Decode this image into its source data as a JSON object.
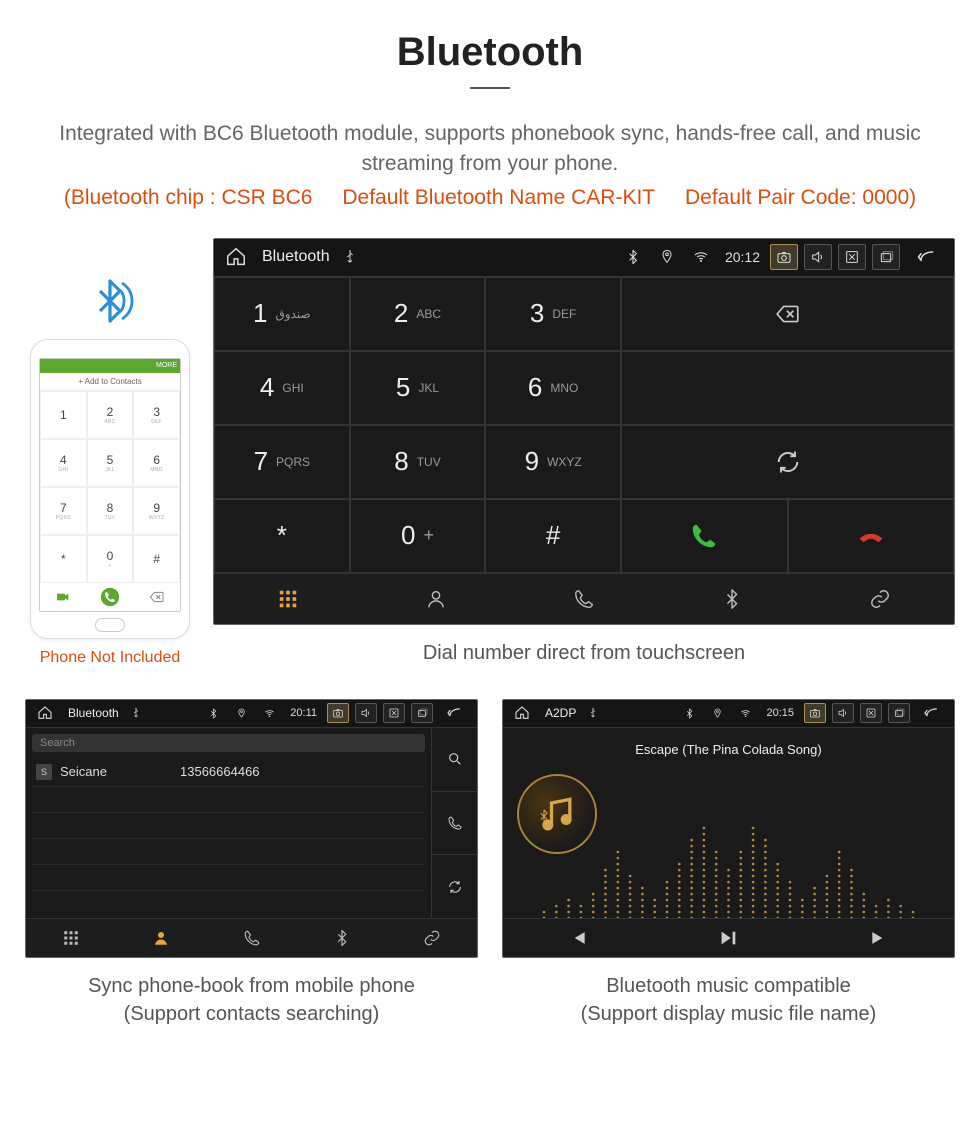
{
  "header": {
    "title": "Bluetooth",
    "description": "Integrated with BC6 Bluetooth module, supports phonebook sync, hands-free call, and music streaming from your phone.",
    "spec_chip": "(Bluetooth chip : CSR BC6",
    "spec_name": "Default Bluetooth Name CAR-KIT",
    "spec_pair": "Default Pair Code: 0000)"
  },
  "phone_mock": {
    "top_label": "MORE",
    "add_contact": "+  Add to Contacts",
    "keys": [
      {
        "d": "1",
        "l": ""
      },
      {
        "d": "2",
        "l": "ABC"
      },
      {
        "d": "3",
        "l": "DEF"
      },
      {
        "d": "4",
        "l": "GHI"
      },
      {
        "d": "5",
        "l": "JKL"
      },
      {
        "d": "6",
        "l": "MNO"
      },
      {
        "d": "7",
        "l": "PQRS"
      },
      {
        "d": "8",
        "l": "TUV"
      },
      {
        "d": "9",
        "l": "WXYZ"
      },
      {
        "d": "*",
        "l": ""
      },
      {
        "d": "0",
        "l": "+"
      },
      {
        "d": "#",
        "l": ""
      }
    ],
    "caption": "Phone Not Included"
  },
  "dialer": {
    "status": {
      "title": "Bluetooth",
      "time": "20:12"
    },
    "keys": [
      {
        "d": "1",
        "l": "صندوق"
      },
      {
        "d": "2",
        "l": "ABC"
      },
      {
        "d": "3",
        "l": "DEF"
      },
      {
        "d": "4",
        "l": "GHI"
      },
      {
        "d": "5",
        "l": "JKL"
      },
      {
        "d": "6",
        "l": "MNO"
      },
      {
        "d": "7",
        "l": "PQRS"
      },
      {
        "d": "8",
        "l": "TUV"
      },
      {
        "d": "9",
        "l": "WXYZ"
      },
      {
        "d": "*",
        "l": ""
      },
      {
        "d": "0",
        "l": "+",
        "plus": true
      },
      {
        "d": "#",
        "l": ""
      }
    ],
    "caption": "Dial number direct from touchscreen"
  },
  "contacts": {
    "status": {
      "title": "Bluetooth",
      "time": "20:11"
    },
    "search_placeholder": "Search",
    "list": [
      {
        "badge": "S",
        "name": "Seicane",
        "number": "13566664466"
      }
    ],
    "caption_l1": "Sync phone-book from mobile phone",
    "caption_l2": "(Support contacts searching)"
  },
  "music": {
    "status": {
      "title": "A2DP",
      "time": "20:15"
    },
    "song": "Escape (The Pina Colada Song)",
    "caption_l1": "Bluetooth music compatible",
    "caption_l2": "(Support display music file name)"
  }
}
